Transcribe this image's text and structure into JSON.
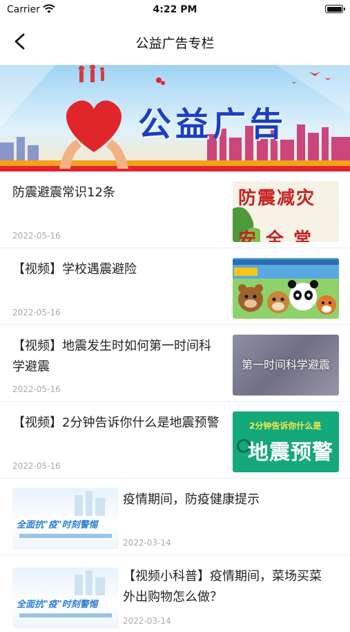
{
  "status": {
    "carrier": "Carrier",
    "time": "4:22 PM"
  },
  "nav": {
    "title": "公益广告专栏"
  },
  "banner": {
    "text": "公益广告"
  },
  "items": [
    {
      "title": "防震避震常识12条",
      "date": "2022-05-16",
      "thumb_text": "防震减灾",
      "thumb_sub": "安全常在"
    },
    {
      "title": "【视频】学校遇震避险",
      "date": "2022-05-16",
      "thumb_text": ""
    },
    {
      "title": "【视频】地震发生时如何第一时间科学避震",
      "date": "2022-05-16",
      "thumb_text": "第一时间科学避震"
    },
    {
      "title": "【视频】2分钟告诉你什么是地震预警",
      "date": "2022-05-16",
      "thumb_top": "2分钟告诉你什么是",
      "thumb_text": "地震预警"
    },
    {
      "title": "疫情期间，防疫健康提示",
      "date": "2022-03-14",
      "thumb_text": "全面抗\"疫\"时刻警惕"
    },
    {
      "title": "【视频小科普】疫情期间，菜场买菜 外出购物怎么做？",
      "date": "2022-03-14",
      "thumb_text": "全面抗\"疫\"时刻警惕"
    }
  ],
  "colors": {
    "accent_red": "#e0262a",
    "banner_blue": "#1b3fc4"
  }
}
